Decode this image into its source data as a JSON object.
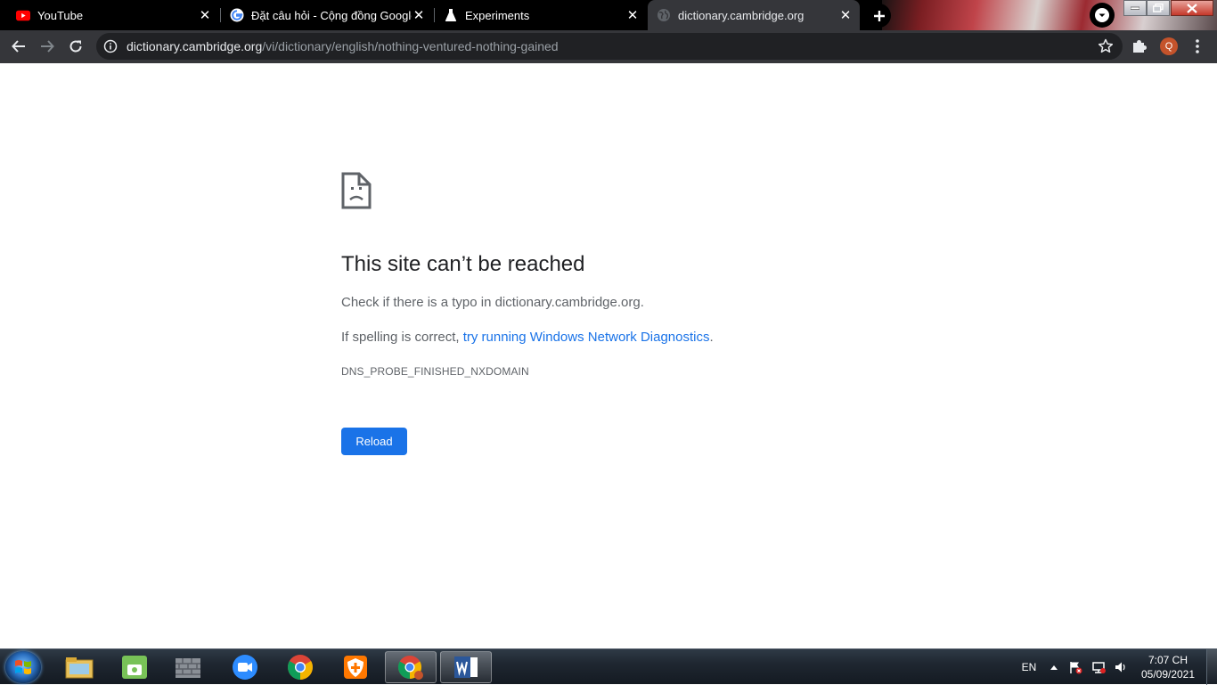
{
  "tabs": [
    {
      "title": "YouTube",
      "favicon": "youtube-icon",
      "active": false
    },
    {
      "title": "Đặt câu hỏi - Cộng đồng Google",
      "favicon": "google-icon",
      "active": false
    },
    {
      "title": "Experiments",
      "favicon": "flask-icon",
      "active": false
    },
    {
      "title": "dictionary.cambridge.org",
      "favicon": "globe-icon",
      "active": true
    }
  ],
  "omnibox": {
    "host": "dictionary.cambridge.org",
    "path": "/vi/dictionary/english/nothing-ventured-nothing-gained"
  },
  "profile": {
    "initial": "Q",
    "color": "#c4532b"
  },
  "error_page": {
    "title": "This site can’t be reached",
    "line1": "Check if there is a typo in dictionary.cambridge.org.",
    "line2_prefix": "If spelling is correct, ",
    "line2_link": "try running Windows Network Diagnostics",
    "line2_suffix": ".",
    "error_code": "DNS_PROBE_FINISHED_NXDOMAIN",
    "reload_label": "Reload"
  },
  "taskbar": {
    "apps": [
      "file-explorer-icon",
      "android-studio-icon",
      "firewall-icon",
      "zoom-icon",
      "chrome-icon",
      "avast-icon",
      "chrome-profile-icon",
      "word-icon"
    ],
    "language": "EN",
    "time": "7:07 CH",
    "date": "05/09/2021"
  },
  "colors": {
    "accent": "#1a73e8",
    "toolbar": "#35363a",
    "omnibox": "#202124"
  }
}
